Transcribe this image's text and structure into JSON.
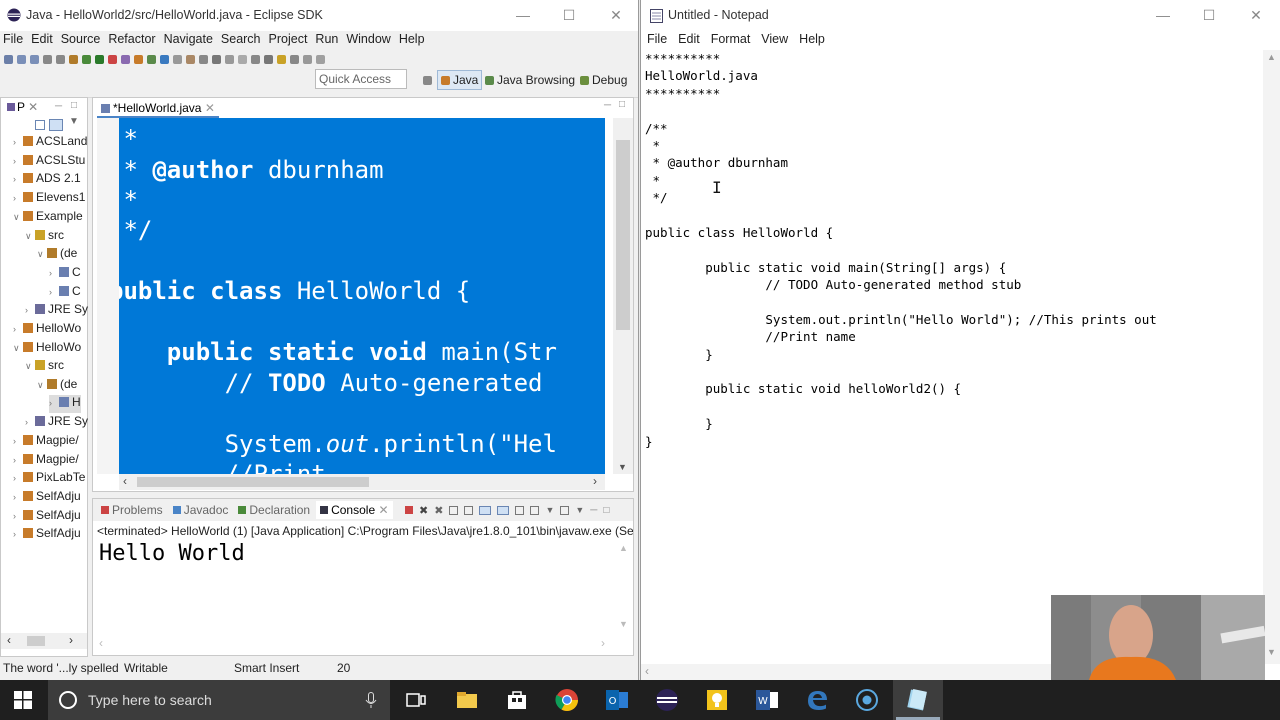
{
  "eclipse": {
    "title": "Java - HelloWorld2/src/HelloWorld.java - Eclipse SDK",
    "menu": [
      "File",
      "Edit",
      "Source",
      "Refactor",
      "Navigate",
      "Search",
      "Project",
      "Run",
      "Window",
      "Help"
    ],
    "quick_access": "Quick Access",
    "perspectives": [
      "Java",
      "Java Browsing",
      "Debug"
    ],
    "package_explorer": {
      "tab": "P",
      "items": [
        "ACSLand",
        "ACSLStu",
        "ADS 2.1",
        "Elevens1",
        "Example",
        "src",
        "(de",
        "C",
        "C",
        "JRE Sy",
        "HelloWo",
        "HelloWo",
        "src",
        "(de",
        "H",
        "JRE Sy",
        "Magpie/",
        "Magpie/",
        "PixLabTe",
        "SelfAdju",
        "SelfAdju",
        "SelfAdju"
      ]
    },
    "editor": {
      "tab": "*HelloWorld.java",
      "lines": [
        {
          "pre": " * ",
          "b": "",
          "rest": ""
        },
        {
          "pre": " * ",
          "b": "@author",
          "rest": " dburnham"
        },
        {
          "pre": " * ",
          "b": "",
          "rest": ""
        },
        {
          "pre": " */",
          "b": "",
          "rest": ""
        },
        {
          "pre": "",
          "b": "",
          "rest": ""
        },
        {
          "pre": "",
          "b": "public class",
          "rest": " HelloWorld {"
        },
        {
          "pre": "",
          "b": "",
          "rest": ""
        },
        {
          "pre": "    ",
          "b": "public static void",
          "rest": " main(Str"
        },
        {
          "pre": "        // ",
          "b": "TODO",
          "rest": " Auto-generated"
        },
        {
          "pre": "",
          "b": "",
          "rest": ""
        },
        {
          "pre": "        System.",
          "b": "",
          "rest": "",
          "it": "out",
          "post": ".println(\"Hel"
        },
        {
          "pre": "        //Print",
          "b": "",
          "rest": ""
        }
      ]
    },
    "console": {
      "tabs": [
        "Problems",
        "Javadoc",
        "Declaration",
        "Console"
      ],
      "terminated": "<terminated> HelloWorld (1) [Java Application] C:\\Program Files\\Java\\jre1.8.0_101\\bin\\javaw.exe (Sep",
      "output": "Hello World"
    },
    "status": {
      "message": "The word '...ly spelled",
      "mode": "Writable",
      "insert": "Smart Insert",
      "position": "20"
    }
  },
  "notepad": {
    "title": "Untitled - Notepad",
    "menu": [
      "File",
      "Edit",
      "Format",
      "View",
      "Help"
    ],
    "lines": [
      "**********",
      "HelloWorld.java",
      "**********",
      "",
      "/**",
      " *",
      " * @author dburnham",
      " *",
      " */",
      "",
      "public class HelloWorld {",
      "",
      "        public static void main(String[] args) {",
      "                // TODO Auto-generated method stub",
      "",
      "                System.out.println(\"Hello World\"); //This prints out",
      "                //Print name",
      "        }",
      "",
      "        public static void helloWorld2() {",
      "",
      "        }",
      "}",
      ""
    ]
  },
  "taskbar": {
    "search_placeholder": "Type here to search"
  },
  "colors": {
    "selection": "#0078d7",
    "taskbar": "#1f1f1f"
  }
}
